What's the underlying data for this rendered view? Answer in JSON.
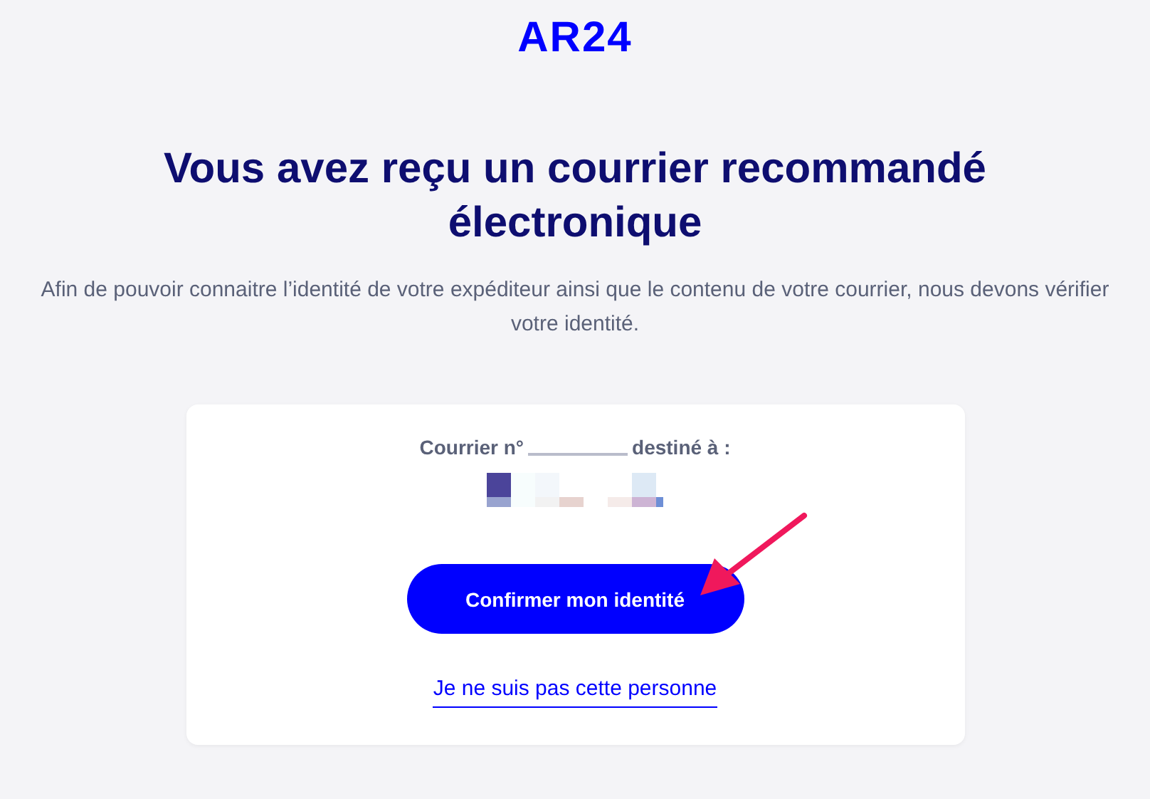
{
  "logo": "AR24",
  "heading": "Vous avez reçu un courrier recommandé électronique",
  "intro": "Afin de pouvoir connaitre l’identité de votre expéditeur ainsi que le contenu de votre courrier, nous devons vérifier votre identité.",
  "card": {
    "courrier_label": "Courrier n°",
    "recipient_label": "destiné à :",
    "confirm_button": "Confirmer mon identité",
    "decline_link": "Je ne suis pas cette personne"
  }
}
